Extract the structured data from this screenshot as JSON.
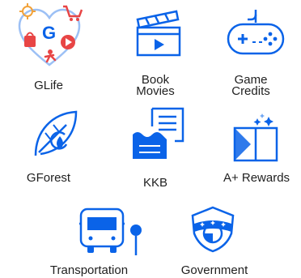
{
  "colors": {
    "primary": "#0a63e8",
    "primary_light": "#6fa6f2",
    "accent_red": "#e84545",
    "accent_orange": "#f2a23a"
  },
  "services": [
    {
      "label": "GLife",
      "icon": "glife-hearts-icon"
    },
    {
      "label": "Book\nMovies",
      "icon": "clapperboard-icon"
    },
    {
      "label": "Game\nCredits",
      "icon": "gamepad-icon"
    },
    {
      "label": "GForest",
      "icon": "leaf-icon"
    },
    {
      "label": "KKB",
      "icon": "receipt-icon"
    },
    {
      "label": "A+ Rewards",
      "icon": "gift-box-icon"
    },
    {
      "label": "Transportation",
      "icon": "bus-icon"
    },
    {
      "label": "Government",
      "icon": "shield-icon"
    }
  ]
}
